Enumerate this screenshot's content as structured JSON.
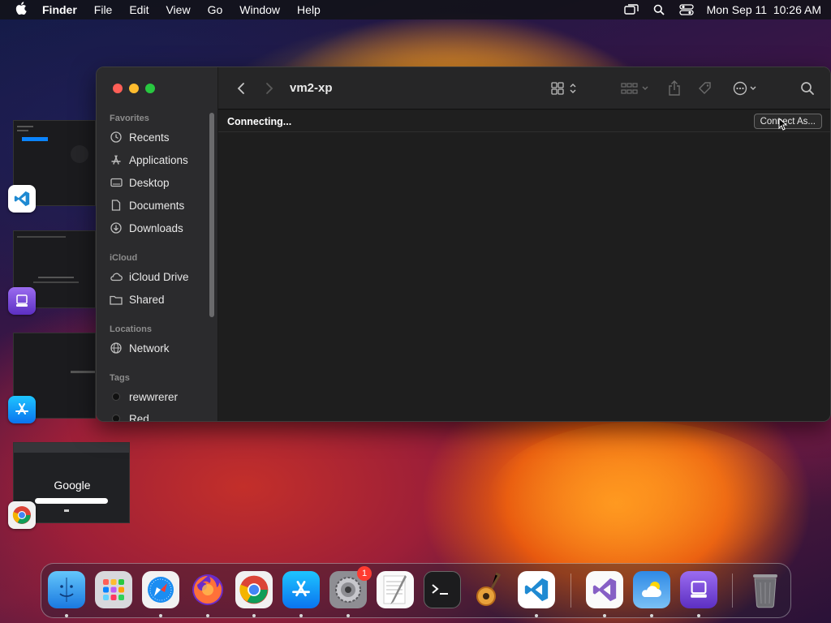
{
  "menubar": {
    "app_name": "Finder",
    "items": [
      "File",
      "Edit",
      "View",
      "Go",
      "Window",
      "Help"
    ],
    "clock": "Mon Sep 11  10:26 AM"
  },
  "finder": {
    "title": "vm2-xp",
    "status": "Connecting...",
    "connect_button": "Connect As...",
    "sidebar": {
      "favorites_header": "Favorites",
      "favorites": [
        "Recents",
        "Applications",
        "Desktop",
        "Documents",
        "Downloads"
      ],
      "icloud_header": "iCloud",
      "icloud": [
        "iCloud Drive",
        "Shared"
      ],
      "locations_header": "Locations",
      "locations": [
        "Network"
      ],
      "tags_header": "Tags",
      "tags": [
        "rewwrerer",
        "Red"
      ]
    }
  },
  "thumbnails": {
    "google_label": "Google"
  },
  "dock": {
    "settings_badge": "1"
  },
  "colors": {
    "accent_blue": "#0a84ff",
    "close": "#ff5f57",
    "minimize": "#febc2e",
    "zoom": "#28c840"
  }
}
